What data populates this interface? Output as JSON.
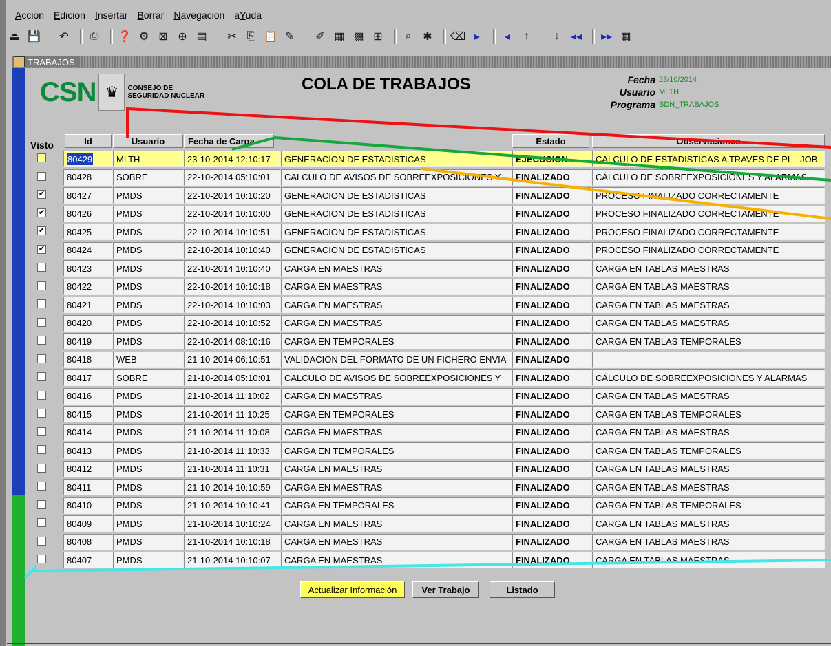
{
  "menu": [
    {
      "pre": "",
      "u": "A",
      "post": "ccion"
    },
    {
      "pre": "",
      "u": "E",
      "post": "dicion"
    },
    {
      "pre": "",
      "u": "I",
      "post": "nsertar"
    },
    {
      "pre": "",
      "u": "B",
      "post": "orrar"
    },
    {
      "pre": "",
      "u": "N",
      "post": "avegacion"
    },
    {
      "pre": "a",
      "u": "Y",
      "post": "uda"
    }
  ],
  "window_title": "TRABAJOS",
  "logo": {
    "csn": "CSN",
    "line1": "CONSEJO DE",
    "line2": "SEGURIDAD NUCLEAR"
  },
  "page_title": "COLA DE TRABAJOS",
  "meta": {
    "fecha_label": "Fecha",
    "fecha_value": "23/10/2014",
    "usuario_label": "Usuario",
    "usuario_value": "MLTH",
    "programa_label": "Programa",
    "programa_value": "BDN_TRABAJOS"
  },
  "columns": {
    "visto": "Visto",
    "id": "Id",
    "usuario": "Usuario",
    "fecha": "Fecha de Carga",
    "estado": "Estado",
    "observaciones": "Observaciones"
  },
  "rows": [
    {
      "visto": false,
      "id": "80429",
      "usuario": "MLTH",
      "fecha": "23-10-2014 12:10:17",
      "programa": "GENERACION DE ESTADISTICAS",
      "estado": "EJECUCION",
      "obs": "CALCULO DE ESTADISTICAS A TRAVES DE PL - JOB"
    },
    {
      "visto": false,
      "id": "80428",
      "usuario": "SOBRE",
      "fecha": "22-10-2014 05:10:01",
      "programa": "CALCULO DE AVISOS DE SOBREEXPOSICIONES Y",
      "estado": "FINALIZADO",
      "obs": "CÁLCULO DE SOBREEXPOSICIONES Y ALARMAS"
    },
    {
      "visto": true,
      "id": "80427",
      "usuario": "PMDS",
      "fecha": "22-10-2014 10:10:20",
      "programa": "GENERACION DE ESTADISTICAS",
      "estado": "FINALIZADO",
      "obs": "PROCESO FINALIZADO CORRECTAMENTE"
    },
    {
      "visto": true,
      "id": "80426",
      "usuario": "PMDS",
      "fecha": "22-10-2014 10:10:00",
      "programa": "GENERACION DE ESTADISTICAS",
      "estado": "FINALIZADO",
      "obs": "PROCESO FINALIZADO CORRECTAMENTE"
    },
    {
      "visto": true,
      "id": "80425",
      "usuario": "PMDS",
      "fecha": "22-10-2014 10:10:51",
      "programa": "GENERACION DE ESTADISTICAS",
      "estado": "FINALIZADO",
      "obs": "PROCESO FINALIZADO CORRECTAMENTE"
    },
    {
      "visto": true,
      "id": "80424",
      "usuario": "PMDS",
      "fecha": "22-10-2014 10:10:40",
      "programa": "GENERACION DE ESTADISTICAS",
      "estado": "FINALIZADO",
      "obs": "PROCESO FINALIZADO CORRECTAMENTE"
    },
    {
      "visto": false,
      "id": "80423",
      "usuario": "PMDS",
      "fecha": "22-10-2014 10:10:40",
      "programa": "CARGA EN MAESTRAS",
      "estado": "FINALIZADO",
      "obs": "CARGA EN TABLAS MAESTRAS"
    },
    {
      "visto": false,
      "id": "80422",
      "usuario": "PMDS",
      "fecha": "22-10-2014 10:10:18",
      "programa": "CARGA EN MAESTRAS",
      "estado": "FINALIZADO",
      "obs": "CARGA EN TABLAS MAESTRAS"
    },
    {
      "visto": false,
      "id": "80421",
      "usuario": "PMDS",
      "fecha": "22-10-2014 10:10:03",
      "programa": "CARGA EN MAESTRAS",
      "estado": "FINALIZADO",
      "obs": "CARGA EN TABLAS MAESTRAS"
    },
    {
      "visto": false,
      "id": "80420",
      "usuario": "PMDS",
      "fecha": "22-10-2014 10:10:52",
      "programa": "CARGA EN MAESTRAS",
      "estado": "FINALIZADO",
      "obs": "CARGA EN TABLAS MAESTRAS"
    },
    {
      "visto": false,
      "id": "80419",
      "usuario": "PMDS",
      "fecha": "22-10-2014 08:10:16",
      "programa": "CARGA EN TEMPORALES",
      "estado": "FINALIZADO",
      "obs": "CARGA EN TABLAS TEMPORALES"
    },
    {
      "visto": false,
      "id": "80418",
      "usuario": "WEB",
      "fecha": "21-10-2014 06:10:51",
      "programa": "VALIDACION DEL FORMATO DE UN FICHERO ENVIA",
      "estado": "FINALIZADO",
      "obs": ""
    },
    {
      "visto": false,
      "id": "80417",
      "usuario": "SOBRE",
      "fecha": "21-10-2014 05:10:01",
      "programa": "CALCULO DE AVISOS DE SOBREEXPOSICIONES Y",
      "estado": "FINALIZADO",
      "obs": "CÁLCULO DE SOBREEXPOSICIONES Y ALARMAS"
    },
    {
      "visto": false,
      "id": "80416",
      "usuario": "PMDS",
      "fecha": "21-10-2014 11:10:02",
      "programa": "CARGA EN MAESTRAS",
      "estado": "FINALIZADO",
      "obs": "CARGA EN TABLAS MAESTRAS"
    },
    {
      "visto": false,
      "id": "80415",
      "usuario": "PMDS",
      "fecha": "21-10-2014 11:10:25",
      "programa": "CARGA EN TEMPORALES",
      "estado": "FINALIZADO",
      "obs": "CARGA EN TABLAS TEMPORALES"
    },
    {
      "visto": false,
      "id": "80414",
      "usuario": "PMDS",
      "fecha": "21-10-2014 11:10:08",
      "programa": "CARGA EN MAESTRAS",
      "estado": "FINALIZADO",
      "obs": "CARGA EN TABLAS MAESTRAS"
    },
    {
      "visto": false,
      "id": "80413",
      "usuario": "PMDS",
      "fecha": "21-10-2014 11:10:33",
      "programa": "CARGA EN TEMPORALES",
      "estado": "FINALIZADO",
      "obs": "CARGA EN TABLAS TEMPORALES"
    },
    {
      "visto": false,
      "id": "80412",
      "usuario": "PMDS",
      "fecha": "21-10-2014 11:10:31",
      "programa": "CARGA EN MAESTRAS",
      "estado": "FINALIZADO",
      "obs": "CARGA EN TABLAS MAESTRAS"
    },
    {
      "visto": false,
      "id": "80411",
      "usuario": "PMDS",
      "fecha": "21-10-2014 10:10:59",
      "programa": "CARGA EN MAESTRAS",
      "estado": "FINALIZADO",
      "obs": "CARGA EN TABLAS MAESTRAS"
    },
    {
      "visto": false,
      "id": "80410",
      "usuario": "PMDS",
      "fecha": "21-10-2014 10:10:41",
      "programa": "CARGA EN TEMPORALES",
      "estado": "FINALIZADO",
      "obs": "CARGA EN TABLAS TEMPORALES"
    },
    {
      "visto": false,
      "id": "80409",
      "usuario": "PMDS",
      "fecha": "21-10-2014 10:10:24",
      "programa": "CARGA EN MAESTRAS",
      "estado": "FINALIZADO",
      "obs": "CARGA EN TABLAS MAESTRAS"
    },
    {
      "visto": false,
      "id": "80408",
      "usuario": "PMDS",
      "fecha": "21-10-2014 10:10:18",
      "programa": "CARGA EN MAESTRAS",
      "estado": "FINALIZADO",
      "obs": "CARGA EN TABLAS MAESTRAS"
    },
    {
      "visto": false,
      "id": "80407",
      "usuario": "PMDS",
      "fecha": "21-10-2014 10:10:07",
      "programa": "CARGA EN MAESTRAS",
      "estado": "FINALIZADO",
      "obs": "CARGA EN TABLAS MAESTRAS"
    }
  ],
  "buttons": {
    "actualizar": "Actualizar Información",
    "ver": "Ver Trabajo",
    "listado": "Listado"
  },
  "icons": [
    "exit-icon",
    "save-icon",
    "undo-icon",
    "print-icon",
    "query-enter-icon",
    "query-execute-icon",
    "query-cancel-icon",
    "zoom-icon",
    "record-icon",
    "cut-icon",
    "copy-icon",
    "paste-icon",
    "edit-icon",
    "clear-icon",
    "insert-record-icon",
    "delete-record-icon",
    "duplicate-icon",
    "find-icon",
    "new-icon",
    "remove-icon",
    "next-icon",
    "previous-icon",
    "up-icon",
    "down-icon",
    "first-icon",
    "last-icon",
    "calculator-icon",
    "flash-icon"
  ],
  "colors": {
    "selected_row": "#ffff8e",
    "accent_blue": "#1b3fb8",
    "accent_green": "#1fb030",
    "meta_value": "#1b8a2a"
  }
}
